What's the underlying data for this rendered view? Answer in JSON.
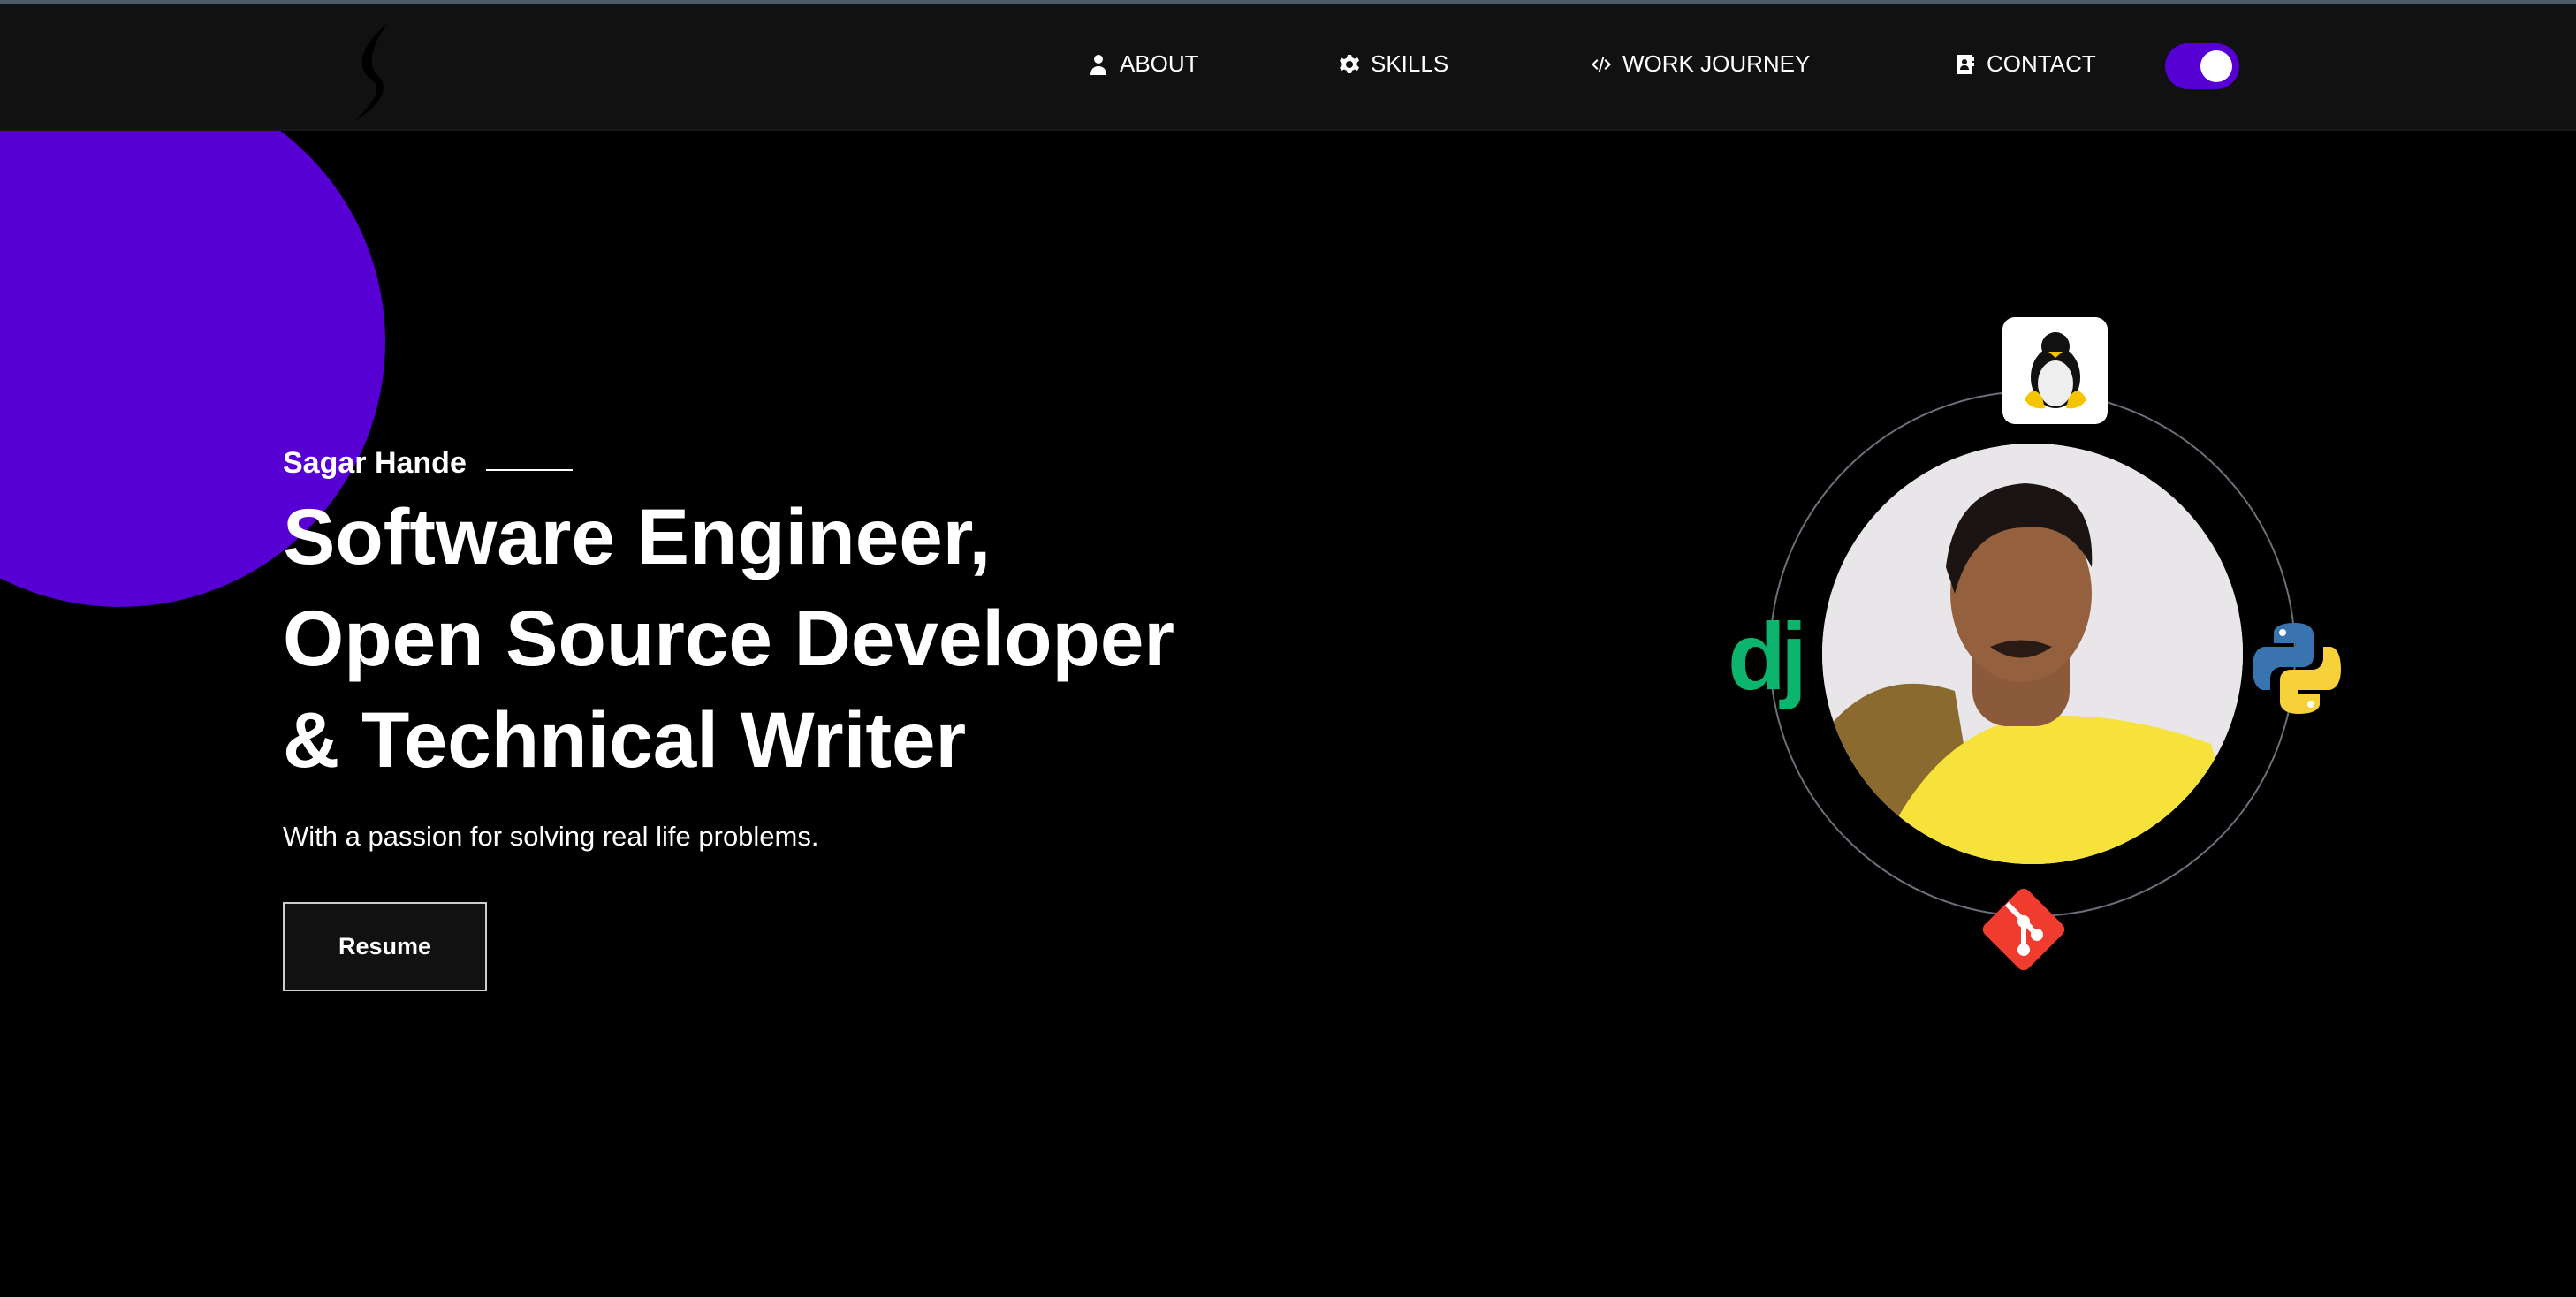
{
  "nav": {
    "items": [
      {
        "label": "ABOUT",
        "icon": "user-icon"
      },
      {
        "label": "SKILLS",
        "icon": "gear-icon"
      },
      {
        "label": "WORK JOURNEY",
        "icon": "code-icon"
      },
      {
        "label": "CONTACT",
        "icon": "contact-card-icon"
      }
    ],
    "theme_toggle_on": true
  },
  "hero": {
    "name": "Sagar Hande",
    "headline": [
      "Software Engineer,",
      "Open Source Developer",
      "& Technical Writer"
    ],
    "subtitle": "With a passion for solving real life problems.",
    "resume_label": "Resume"
  },
  "tech_icons": [
    "linux-icon",
    "django-icon",
    "python-icon",
    "git-icon"
  ],
  "django_text": "dj",
  "colors": {
    "accent": "#5600d4",
    "nav_bg": "#111111",
    "django": "#0cb46e",
    "git": "#f03c2e"
  }
}
